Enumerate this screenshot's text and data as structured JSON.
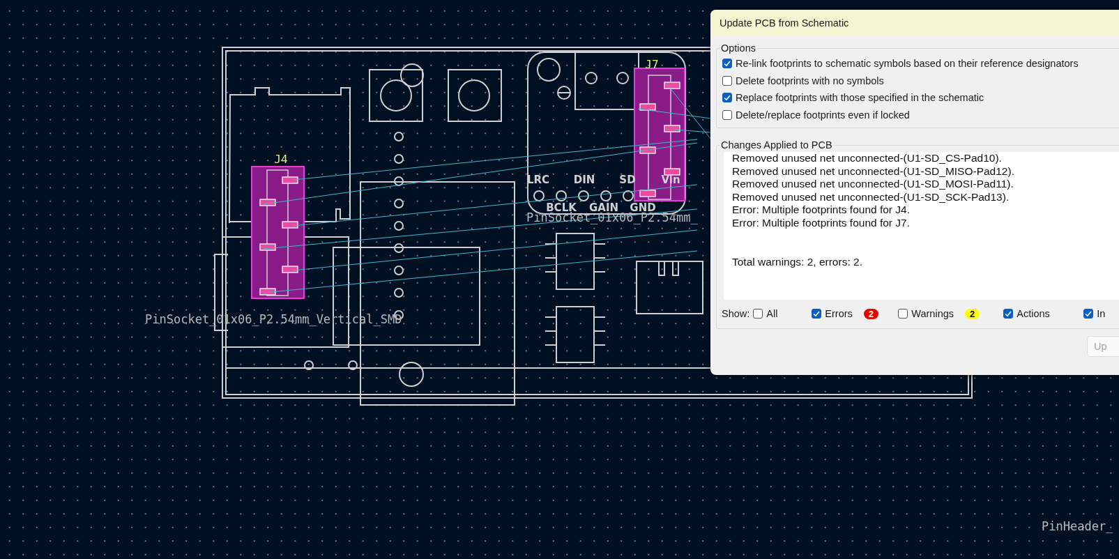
{
  "pcb": {
    "references": [
      "J4",
      "J7"
    ],
    "pin_labels": [
      "LRC",
      "DIN",
      "SD",
      "Vin",
      "BCLK",
      "GAIN",
      "GND"
    ],
    "footprint_labels": [
      "PinSocket_01x06_P2.54mm_Vertical_SMD",
      "PinSocket_01x06_P2.54mm_",
      "PinHeader_"
    ]
  },
  "dialog": {
    "title": "Update PCB from Schematic",
    "options_title": "Options",
    "options": [
      {
        "label": "Re-link footprints to schematic symbols based on their reference designators",
        "checked": true
      },
      {
        "label": "Delete footprints with no symbols",
        "checked": false
      },
      {
        "label": "Replace footprints with those specified in the schematic",
        "checked": true
      },
      {
        "label": "Delete/replace footprints even if locked",
        "checked": false
      }
    ],
    "changes_title": "Changes Applied to PCB",
    "log": [
      "Removed unused net unconnected-(U1-SD_CS-Pad10).",
      "Removed unused net unconnected-(U1-SD_MISO-Pad12).",
      "Removed unused net unconnected-(U1-SD_MOSI-Pad11).",
      "Removed unused net unconnected-(U1-SD_SCK-Pad13).",
      "Error: Multiple footprints found for J4.",
      "Error: Multiple footprints found for J7."
    ],
    "total": "Total warnings: 2, errors: 2.",
    "show_label": "Show:",
    "filters": [
      {
        "label": "All",
        "checked": false
      },
      {
        "label": "Errors",
        "checked": true,
        "badge": "2",
        "color": "#ee0000"
      },
      {
        "label": "Warnings",
        "checked": false,
        "badge": "2",
        "color": "#ffff00"
      },
      {
        "label": "Actions",
        "checked": true
      },
      {
        "label": "In",
        "checked": true
      }
    ],
    "update_button": {
      "label": "Up",
      "disabled": true
    }
  }
}
